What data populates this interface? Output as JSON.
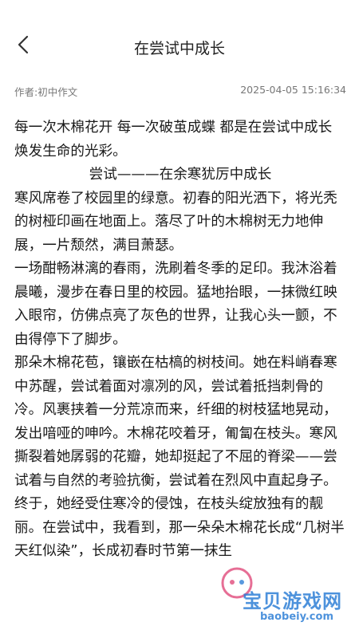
{
  "header": {
    "back_icon": "chevron-left-icon",
    "title": "在尝试中成长"
  },
  "meta": {
    "author": "作者:初中作文",
    "date": "2025-04-05 15:16:34"
  },
  "article": {
    "intro": "每一次木棉花开 每一次破茧成蝶 都是在尝试中成长 焕发生命的光彩。",
    "subtitle": "尝试———在余寒犹厉中成长",
    "paragraphs": [
      "寒风席卷了校园里的绿意。初春的阳光洒下，将光秃的树桠印画在地面上。落尽了叶的木棉树无力地伸展，一片颓然，满目萧瑟。",
      "一场酣畅淋漓的春雨，洗刷着冬季的足印。我沐浴着晨曦，漫步在春日里的校园。猛地抬眼，一抹微红映入眼帘，仿佛点亮了灰色的世界，让我心头一颤，不由得停下了脚步。",
      "那朵木棉花苞，镶嵌在枯槁的树枝间。她在料峭春寒中苏醒，尝试着面对凛冽的风，尝试着抵挡刺骨的冷。风裹挟着一分荒凉而来，纤细的树枝猛地晃动，发出喑哑的呻吟。木棉花咬着牙，匍匐在枝头。寒风撕裂着她孱弱的花瓣，她却挺起了不屈的脊梁——尝试着与自然的考验抗衡，尝试着在烈风中直起身子。",
      "终于，她经受住寒冷的侵蚀，在枝头绽放独有的靓丽。在尝试中，我看到，那一朵朵木棉花长成“几树半天红似染”，长成初春时节第一抹生"
    ]
  },
  "watermark": {
    "text": "宝贝游戏网",
    "url": "baobeiy.com",
    "color": "#2f7fd6"
  }
}
